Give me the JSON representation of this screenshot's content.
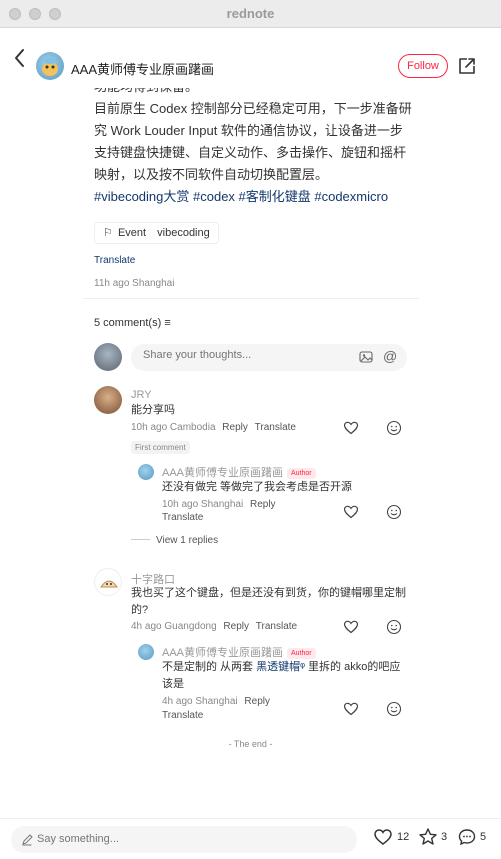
{
  "window": {
    "title": "rednote"
  },
  "header": {
    "author_name": "AAA黄师傅专业原画躇画",
    "follow_label": "Follow"
  },
  "post": {
    "body_line_1": "功能均得到保留。",
    "body_line_2": "目前原生 Codex 控制部分已经稳定可用，下一步准备研究 Work Louder Input 软件的通信协议，让设备进一步支持键盘快捷键、自定义动作、多击操作、旋钮和摇杆映射，以及按不同软件自动切换配置层。",
    "hashtags": "#vibecoding大赏 #codex #客制化键盘 #codexmicro",
    "event_label": "Event",
    "event_value": "vibecoding",
    "translate_label": "Translate",
    "meta": "11h ago Shanghai"
  },
  "comments": {
    "count_label": "5 comment(s)",
    "input_placeholder": "Share your thoughts..."
  },
  "thread": [
    {
      "name": "JRY",
      "text": "能分享吗",
      "time_loc": "10h ago Cambodia",
      "reply": "Reply",
      "translate": "Translate",
      "badge": "First comment",
      "replies": [
        {
          "name": "AAA黄师傅专业原画躇画",
          "author_badge": "Author",
          "text": "还没有做完 等做完了我会考虑是否开源",
          "time_loc": "10h ago Shanghai",
          "reply": "Reply",
          "translate": "Translate"
        }
      ],
      "view_replies": "View 1 replies"
    },
    {
      "name": "十字路口",
      "text": "我也买了这个键盘，但是还没有到货，你的键帽哪里定制的?",
      "time_loc": "4h ago Guangdong",
      "reply": "Reply",
      "translate": "Translate",
      "replies": [
        {
          "name": "AAA黄师傅专业原画躇画",
          "author_badge": "Author",
          "text_before": "不是定制的 从两套",
          "link": "黑透键帽",
          "text_after": "里拆的 akko的吧应该是",
          "time_loc": "4h ago Shanghai",
          "reply": "Reply",
          "translate": "Translate"
        }
      ]
    }
  ],
  "end_label": "- The end -",
  "bottom": {
    "say_placeholder": "Say something...",
    "likes": "12",
    "stars": "3",
    "comments": "5"
  },
  "colors": {
    "accent": "#ff2442",
    "hashtag": "#13386c"
  }
}
